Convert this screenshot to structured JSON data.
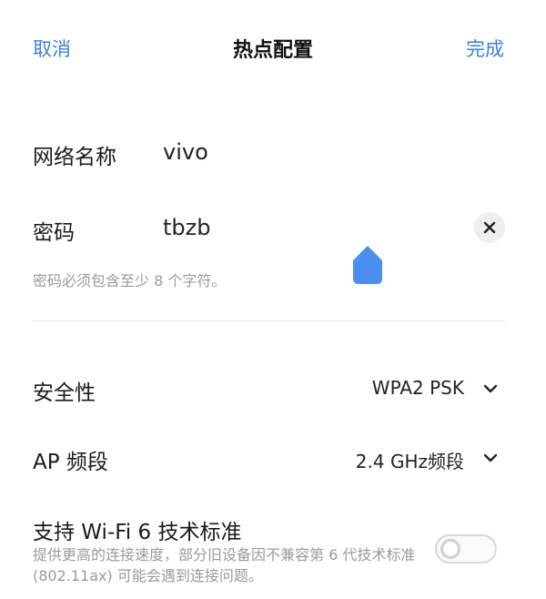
{
  "header": {
    "cancel_label": "取消",
    "title": "热点配置",
    "done_label": "完成"
  },
  "form": {
    "ssid": {
      "label": "网络名称",
      "value": "vivo"
    },
    "password": {
      "label": "密码",
      "value": "tbzb",
      "hint": "密码必须包含至少 8 个字符。",
      "clear_icon": "close-icon"
    },
    "security": {
      "label": "安全性",
      "value": "WPA2 PSK",
      "icon": "chevron-down-icon"
    },
    "ap_band": {
      "label": "AP 频段",
      "value": "2.4 GHz频段",
      "icon": "chevron-down-icon"
    },
    "wifi6": {
      "label": "支持 Wi-Fi 6 技术标准",
      "description": "提供更高的连接速度，部分旧设备因不兼容第 6 代技术标准 (802.11ax) 可能会遇到连接问题。",
      "enabled": false
    }
  },
  "colors": {
    "accent": "#3c7fe0",
    "cursor_handle": "#4a8ff0",
    "hint_text": "#9a9a9a"
  }
}
